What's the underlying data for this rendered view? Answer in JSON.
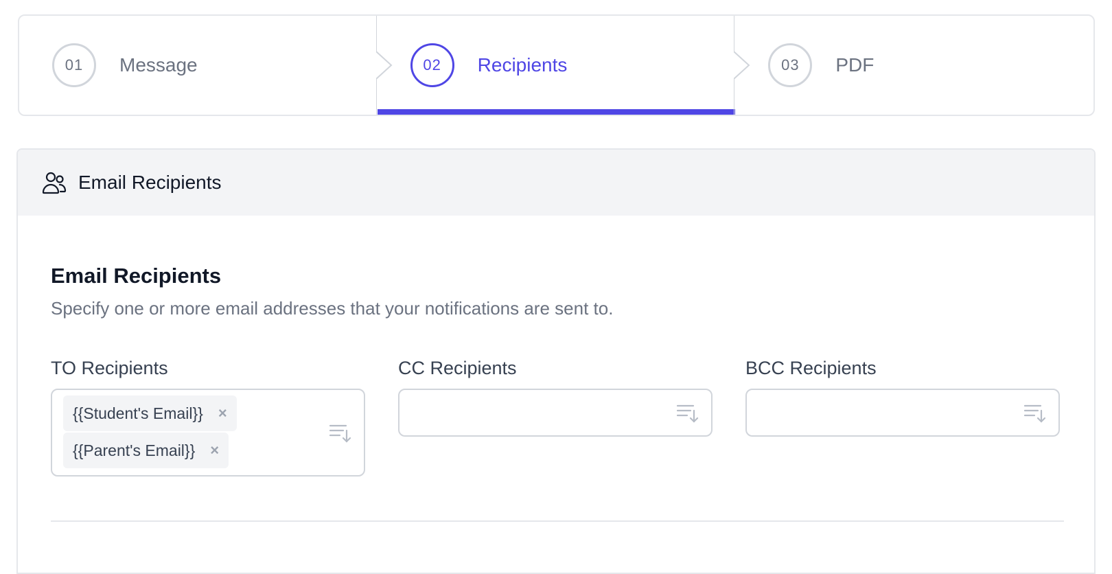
{
  "stepper": {
    "steps": [
      {
        "number": "01",
        "label": "Message",
        "state": "inactive"
      },
      {
        "number": "02",
        "label": "Recipients",
        "state": "active"
      },
      {
        "number": "03",
        "label": "PDF",
        "state": "inactive"
      }
    ],
    "active_color": "#4f46e5",
    "inactive_color": "#6b7280"
  },
  "panel": {
    "header_icon": "users-icon",
    "header_title": "Email Recipients",
    "section_title": "Email Recipients",
    "section_description": "Specify one or more email addresses that your notifications are sent to.",
    "fields": {
      "to": {
        "label": "TO Recipients",
        "chips": [
          "{{Student's Email}}",
          "{{Parent's Email}}"
        ]
      },
      "cc": {
        "label": "CC Recipients",
        "chips": []
      },
      "bcc": {
        "label": "BCC Recipients",
        "chips": []
      }
    },
    "chip_remove_glyph": "×",
    "field_icon": "sort-descending-icon"
  }
}
